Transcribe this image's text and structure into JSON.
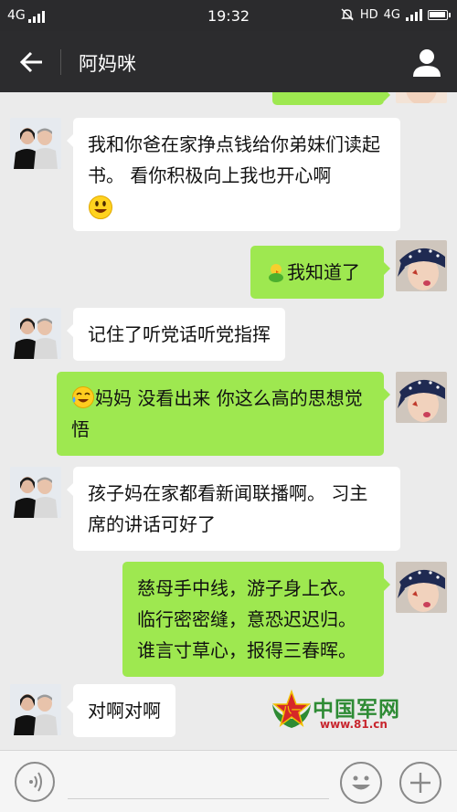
{
  "status_bar": {
    "network_left": "4G",
    "time": "19:32",
    "hd": "HD",
    "network_right": "4G"
  },
  "header": {
    "title": "阿妈咪"
  },
  "messages": [
    {
      "side": "left",
      "text": "我和你爸在家挣点钱给你弟妹们读起书。  看你积极向上我也开心啊",
      "emoji": "smile"
    },
    {
      "side": "right",
      "text": "我知道了",
      "emoji": "chick"
    },
    {
      "side": "left",
      "text": "记住了听党话听党指挥"
    },
    {
      "side": "right",
      "text": "妈妈 没看出来 你这么高的思想觉悟",
      "emoji": "cry-laugh"
    },
    {
      "side": "left",
      "text": "孩子妈在家都看新闻联播啊。  习主席的讲话可好了"
    },
    {
      "side": "right",
      "text": "慈母手中线，游子身上衣。临行密密缝，意恐迟迟归。谁言寸草心，报得三春晖。"
    },
    {
      "side": "left",
      "text": "对啊对啊"
    }
  ],
  "watermark": {
    "name": "中国军网",
    "url": "www.81.cn"
  },
  "colors": {
    "title_bar": "#2c2c2e",
    "bubble_right": "#9ee850",
    "bubble_left": "#ffffff",
    "chat_bg": "#ebebeb"
  }
}
